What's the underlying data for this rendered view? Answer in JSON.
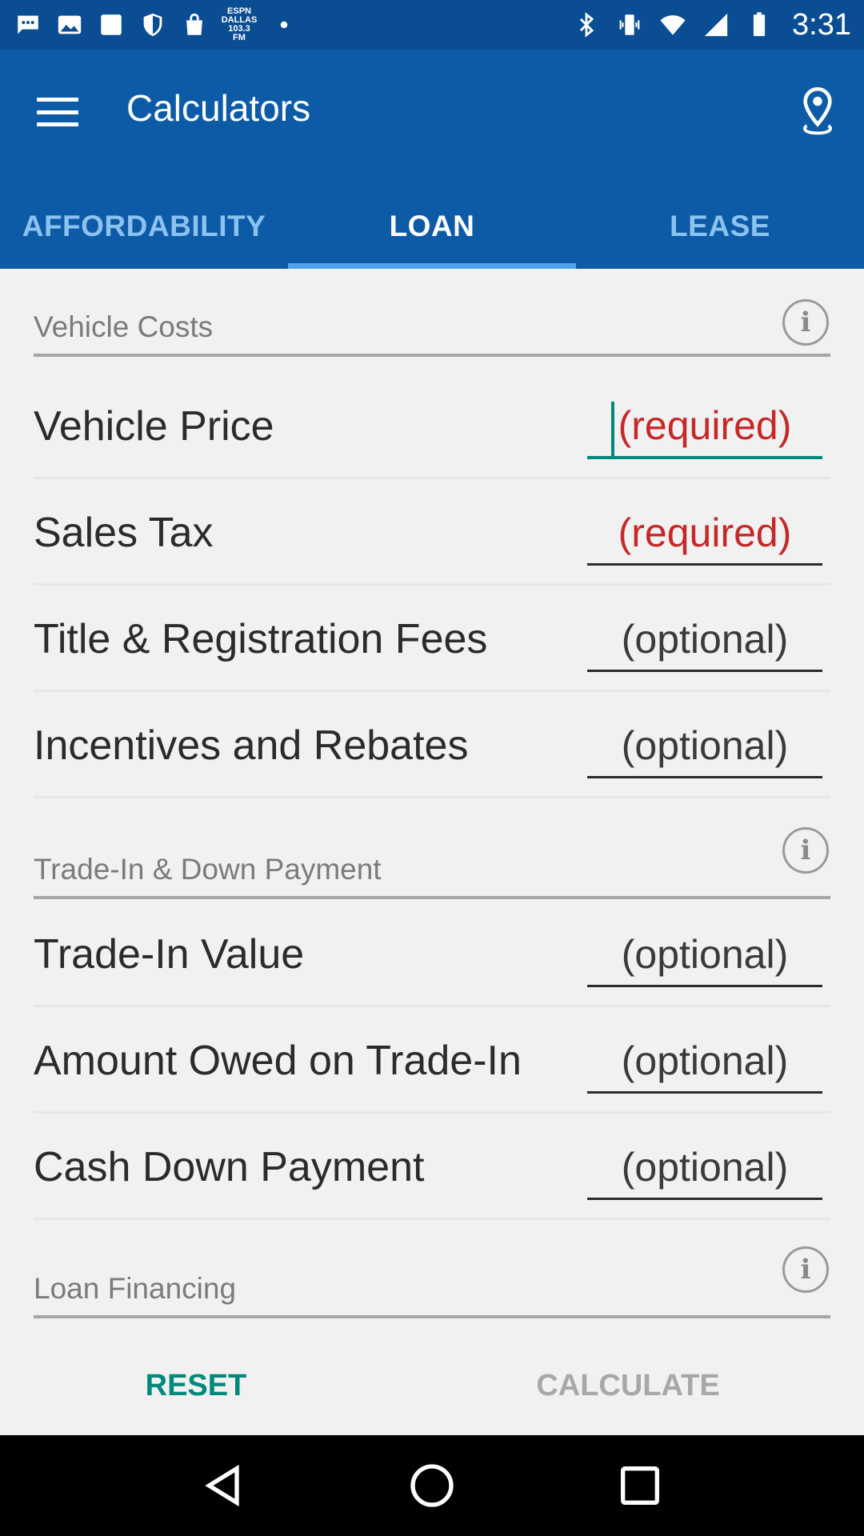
{
  "status_bar": {
    "time": "3:31",
    "espn_widget_text": "ESPN DALLAS 103.3 FM"
  },
  "app_bar": {
    "title": "Calculators",
    "menu_icon": "hamburger-menu-icon",
    "location_icon": "location-pin-icon"
  },
  "tabs": [
    {
      "label": "AFFORDABILITY",
      "active": false
    },
    {
      "label": "LOAN",
      "active": true
    },
    {
      "label": "LEASE",
      "active": false
    }
  ],
  "sections": {
    "vehicle_costs": {
      "title": "Vehicle Costs",
      "fields": [
        {
          "label": "Vehicle Price",
          "placeholder": "(required)",
          "value": ""
        },
        {
          "label": "Sales Tax",
          "placeholder": "(required)",
          "value": ""
        },
        {
          "label": "Title & Registration Fees",
          "placeholder": "(optional)",
          "value": ""
        },
        {
          "label": "Incentives and Rebates",
          "placeholder": "(optional)",
          "value": ""
        }
      ]
    },
    "trade_in": {
      "title": "Trade-In & Down Payment",
      "fields": [
        {
          "label": "Trade-In Value",
          "placeholder": "(optional)",
          "value": ""
        },
        {
          "label": "Amount Owed on Trade-In",
          "placeholder": "(optional)",
          "value": ""
        },
        {
          "label": "Cash Down Payment",
          "placeholder": "(optional)",
          "value": ""
        }
      ]
    },
    "loan_financing": {
      "title": "Loan Financing"
    }
  },
  "buttons": {
    "reset": "RESET",
    "calculate": "CALCULATE"
  },
  "colors": {
    "app_bar": "#0d5ba7",
    "status_bar": "#0a4d92",
    "required": "#c62828",
    "accent": "#00897b"
  }
}
